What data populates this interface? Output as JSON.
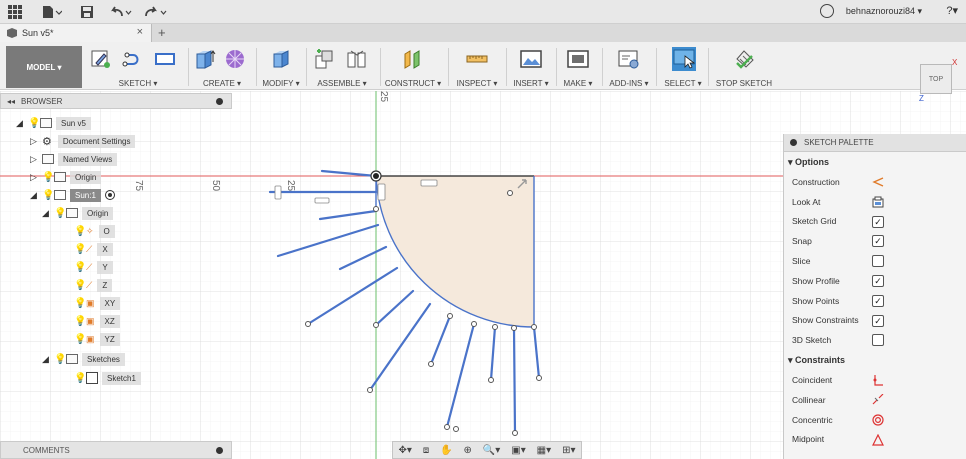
{
  "app": {
    "username": "behnaznorouzi84 ▾",
    "help_label": "?▾"
  },
  "tab": {
    "title": "Sun v5*",
    "close": "×",
    "add": "+"
  },
  "toolbar": {
    "model_label": "MODEL ▾",
    "groups": [
      {
        "label": "SKETCH ▾"
      },
      {
        "label": "CREATE ▾"
      },
      {
        "label": "MODIFY ▾"
      },
      {
        "label": "ASSEMBLE ▾"
      },
      {
        "label": "CONSTRUCT ▾"
      },
      {
        "label": "INSPECT ▾"
      },
      {
        "label": "INSERT ▾"
      },
      {
        "label": "MAKE ▾"
      },
      {
        "label": "ADD-INS ▾"
      },
      {
        "label": "SELECT ▾"
      },
      {
        "label": "STOP SKETCH"
      }
    ]
  },
  "browser": {
    "title": "BROWSER",
    "items": [
      {
        "label": "Sun v5"
      },
      {
        "label": "Document Settings"
      },
      {
        "label": "Named Views"
      },
      {
        "label": "Origin"
      },
      {
        "label": "Sun:1"
      },
      {
        "label": "Origin"
      },
      {
        "label": "O"
      },
      {
        "label": "X"
      },
      {
        "label": "Y"
      },
      {
        "label": "Z"
      },
      {
        "label": "XY"
      },
      {
        "label": "XZ"
      },
      {
        "label": "YZ"
      },
      {
        "label": "Sketches"
      },
      {
        "label": "Sketch1"
      }
    ]
  },
  "comments": {
    "title": "COMMENTS"
  },
  "palette": {
    "title": "SKETCH PALETTE",
    "options_header": "▾ Options",
    "options": [
      {
        "label": "Construction",
        "control": "construction-icon"
      },
      {
        "label": "Look At",
        "control": "look-at-icon"
      },
      {
        "label": "Sketch Grid",
        "checked": true
      },
      {
        "label": "Snap",
        "checked": true
      },
      {
        "label": "Slice",
        "checked": false
      },
      {
        "label": "Show Profile",
        "checked": true
      },
      {
        "label": "Show Points",
        "checked": true
      },
      {
        "label": "Show Constraints",
        "checked": true
      },
      {
        "label": "3D Sketch",
        "checked": false
      }
    ],
    "constraints_header": "▾ Constraints",
    "constraints": [
      {
        "label": "Coincident",
        "control": "coincident-icon"
      },
      {
        "label": "Collinear",
        "control": "collinear-icon"
      },
      {
        "label": "Concentric",
        "control": "concentric-icon"
      },
      {
        "label": "Midpoint",
        "control": "midpoint-icon"
      }
    ]
  },
  "viewcube": {
    "face": "TOP",
    "x": "X",
    "z": "Z"
  },
  "rulers": {
    "top": "25",
    "r1": "75",
    "r2": "50",
    "r3": "25"
  },
  "colors": {
    "accent": "#4a73c9",
    "profile_fill": "#f5e9dc",
    "axis_red": "#e05a5a",
    "axis_green": "#6bbf6b"
  }
}
